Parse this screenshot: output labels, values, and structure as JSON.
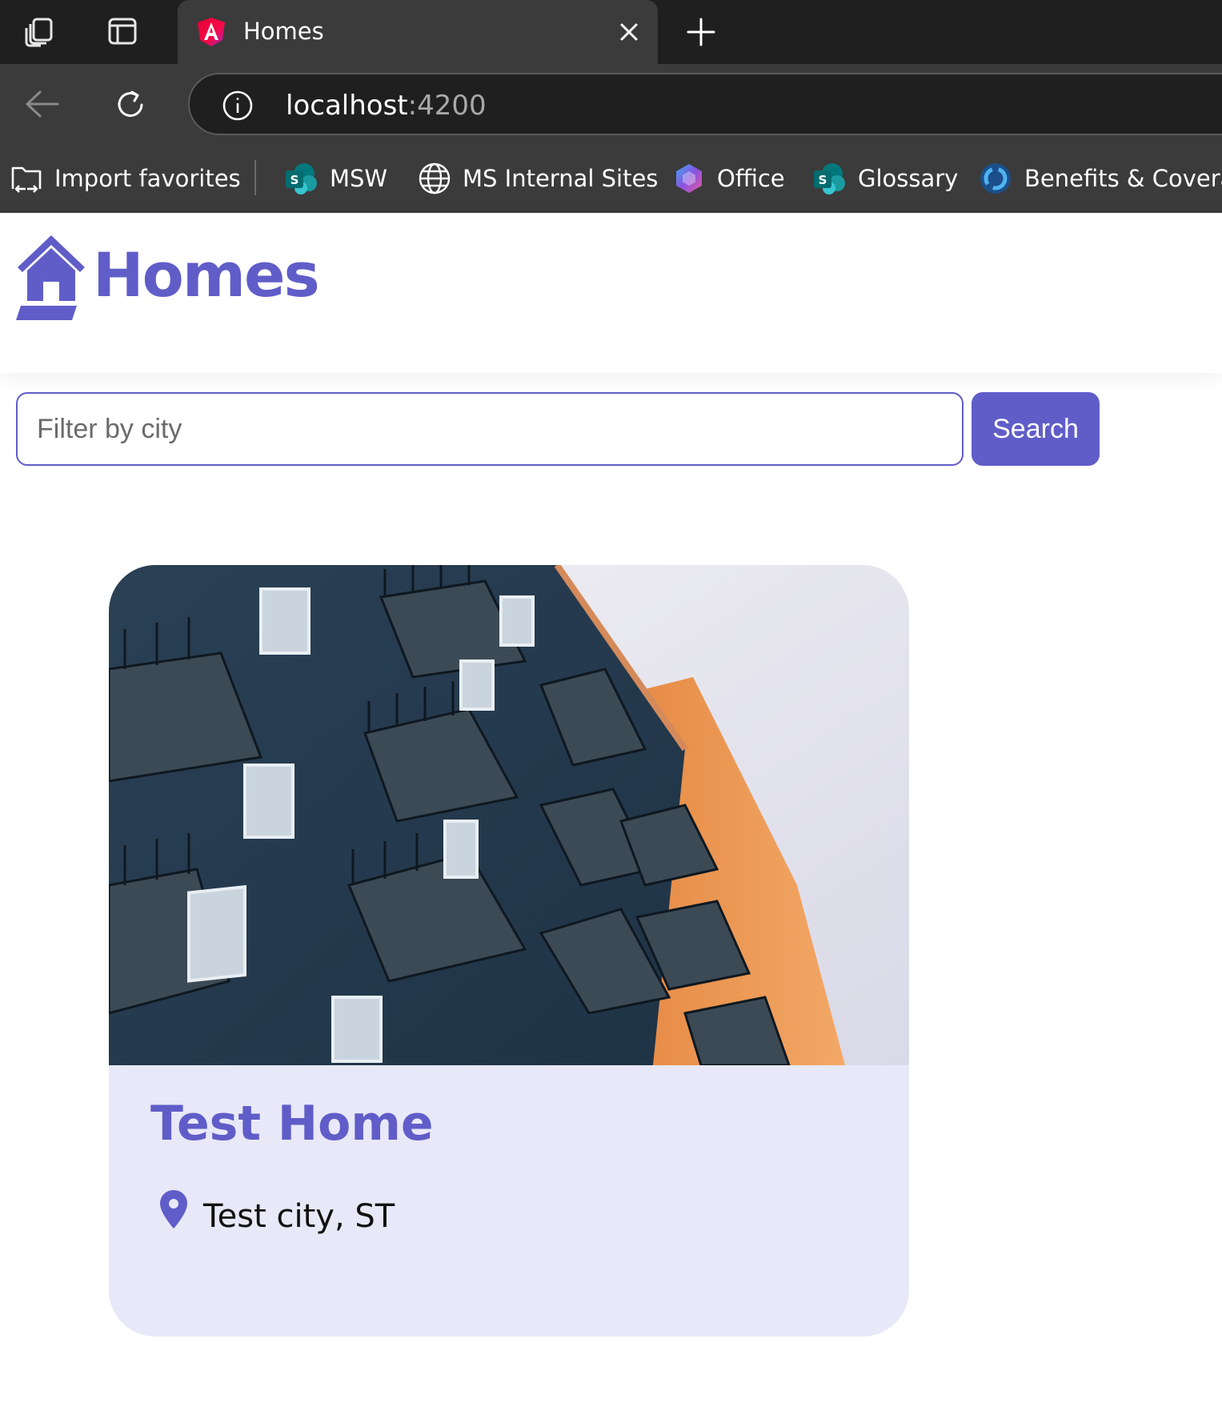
{
  "browser": {
    "tab": {
      "title": "Homes"
    },
    "address": {
      "host": "localhost",
      "port": ":4200"
    },
    "favorites": [
      {
        "label": "Import favorites",
        "icon": "import-favorites-icon"
      },
      {
        "label": "MSW",
        "icon": "sharepoint-icon"
      },
      {
        "label": "MS Internal Sites",
        "icon": "globe-icon"
      },
      {
        "label": "Office",
        "icon": "office-icon"
      },
      {
        "label": "Glossary",
        "icon": "sharepoint-icon"
      },
      {
        "label": "Benefits & Coverag",
        "icon": "benefits-icon"
      }
    ]
  },
  "app": {
    "logo_text": "Homes",
    "brand_color": "#605DC8",
    "filter": {
      "placeholder": "Filter by city",
      "value": ""
    },
    "search_label": "Search",
    "listings": [
      {
        "name": "Test Home",
        "location": "Test city, ST"
      }
    ]
  }
}
